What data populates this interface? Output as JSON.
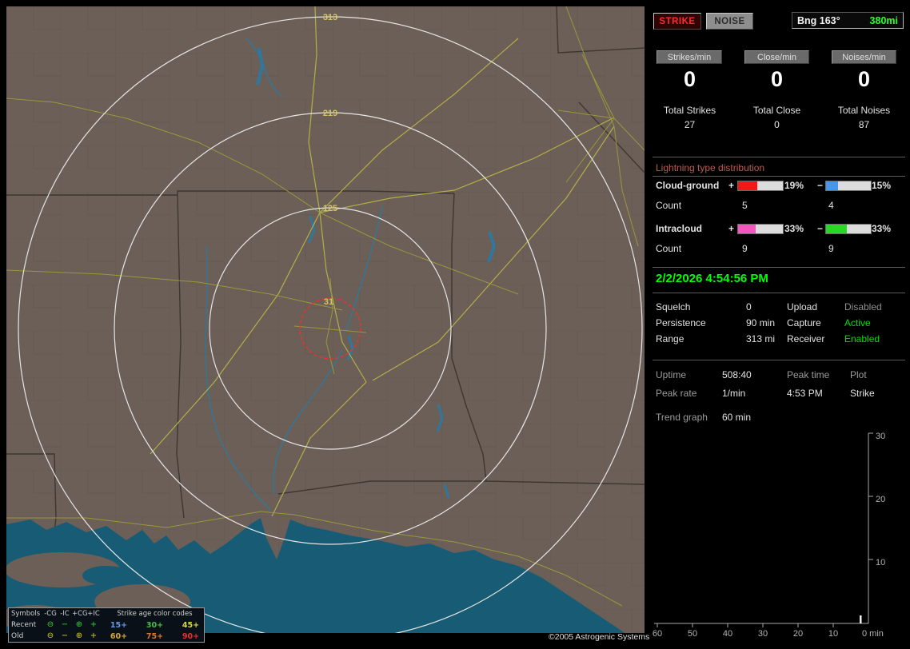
{
  "colors": {
    "accent_green": "#00ff00",
    "strike_red": "#ff2a2a",
    "water": "#175c74",
    "land": "#6c5f57"
  },
  "map": {
    "ring_labels": [
      "313",
      "219",
      "125",
      "31"
    ],
    "copyright": "©2005 Astrogenic Systems",
    "legend": {
      "symbols_header": "Symbols",
      "symbol_cols": [
        "-CG",
        "-IC",
        "+CG",
        "+IC"
      ],
      "age_header": "Strike age color codes",
      "symbols": [
        "⊖",
        "−",
        "⊕",
        "+"
      ],
      "rows": [
        {
          "label": "Recent",
          "symbol_color": "#38d038",
          "ages": [
            {
              "text": "15+",
              "color": "#6898e8"
            },
            {
              "text": "30+",
              "color": "#48c048"
            },
            {
              "text": "45+",
              "color": "#d8d848"
            }
          ]
        },
        {
          "label": "Old",
          "symbol_color": "#d8d030",
          "ages": [
            {
              "text": "60+",
              "color": "#d8a838"
            },
            {
              "text": "75+",
              "color": "#e07828"
            },
            {
              "text": "90+",
              "color": "#e83030"
            }
          ]
        }
      ]
    }
  },
  "panel": {
    "strike_button": "STRIKE",
    "noise_button": "NOISE",
    "bearing_label": "Bng 163°",
    "bearing_value": "380mi",
    "rates": [
      {
        "label": "Strikes/min",
        "value": "0",
        "total_label": "Total Strikes",
        "total_value": "27"
      },
      {
        "label": "Close/min",
        "value": "0",
        "total_label": "Total Close",
        "total_value": "0"
      },
      {
        "label": "Noises/min",
        "value": "0",
        "total_label": "Total Noises",
        "total_value": "87"
      }
    ],
    "distribution": {
      "title": "Lightning type distribution",
      "count_label": "Count",
      "rows": [
        {
          "name": "Cloud-ground",
          "plus_sign": "+",
          "minus_sign": "−",
          "plus_pct": "19%",
          "minus_pct": "15%",
          "plus_color": "#f01818",
          "minus_color": "#4896e8",
          "plus_fill": "43%",
          "minus_fill": "26%",
          "plus_count": "5",
          "minus_count": "4"
        },
        {
          "name": "Intracloud",
          "plus_sign": "+",
          "minus_sign": "−",
          "plus_pct": "33%",
          "minus_pct": "33%",
          "plus_color": "#f058c0",
          "minus_color": "#28d828",
          "plus_fill": "40%",
          "minus_fill": "47%",
          "plus_count": "9",
          "minus_count": "9"
        }
      ]
    },
    "datetime": "2/2/2026 4:54:56 PM",
    "settings": {
      "rows": [
        {
          "l1": "Squelch",
          "v1": "0",
          "l2": "Upload",
          "v2": "Disabled",
          "v2_color": "#8f8f8f"
        },
        {
          "l1": "Persistence",
          "v1": "90 min",
          "l2": "Capture",
          "v2": "Active",
          "v2_color": "#00dd00"
        },
        {
          "l1": "Range",
          "v1": "313 mi",
          "l2": "Receiver",
          "v2": "Enabled",
          "v2_color": "#00dd00"
        }
      ]
    },
    "stats": {
      "uptime_label": "Uptime",
      "uptime_value": "508:40",
      "peak_time_label": "Peak time",
      "peak_time_value": "4:53 PM",
      "plot_label": "Plot",
      "plot_value": "Strike",
      "peak_rate_label": "Peak rate",
      "peak_rate_value": "1/min",
      "trend_label": "Trend graph",
      "trend_value": "60 min"
    },
    "graph": {
      "y_ticks": [
        "30",
        "20",
        "10"
      ],
      "x_ticks": [
        "60",
        "50",
        "40",
        "30",
        "20",
        "10"
      ],
      "x_zero_label": "0 min"
    }
  }
}
